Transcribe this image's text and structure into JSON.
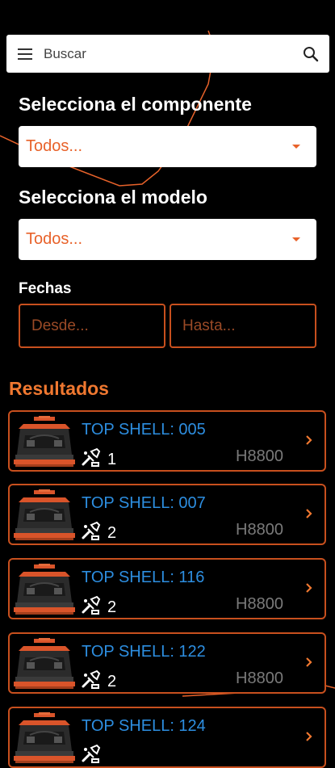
{
  "search": {
    "placeholder": "Buscar"
  },
  "filters": {
    "component_label": "Selecciona el componente",
    "component_value": "Todos...",
    "model_label": "Selecciona el modelo",
    "model_value": "Todos...",
    "dates_label": "Fechas",
    "from_placeholder": "Desde...",
    "to_placeholder": "Hasta..."
  },
  "results": {
    "title": "Resultados",
    "items": [
      {
        "title": "TOP SHELL: 005",
        "count": "1",
        "model": "H8800"
      },
      {
        "title": "TOP SHELL: 007",
        "count": "2",
        "model": "H8800"
      },
      {
        "title": "TOP SHELL: 116",
        "count": "2",
        "model": "H8800"
      },
      {
        "title": "TOP SHELL: 122",
        "count": "2",
        "model": "H8800"
      },
      {
        "title": "TOP SHELL: 124",
        "count": "",
        "model": ""
      }
    ]
  },
  "colors": {
    "accent": "#e8622a",
    "link": "#2d8ee0",
    "background": "#000000"
  },
  "icons": [
    "menu-icon",
    "search-icon",
    "dropdown-caret-icon",
    "tool-icon",
    "chevron-right-icon"
  ]
}
